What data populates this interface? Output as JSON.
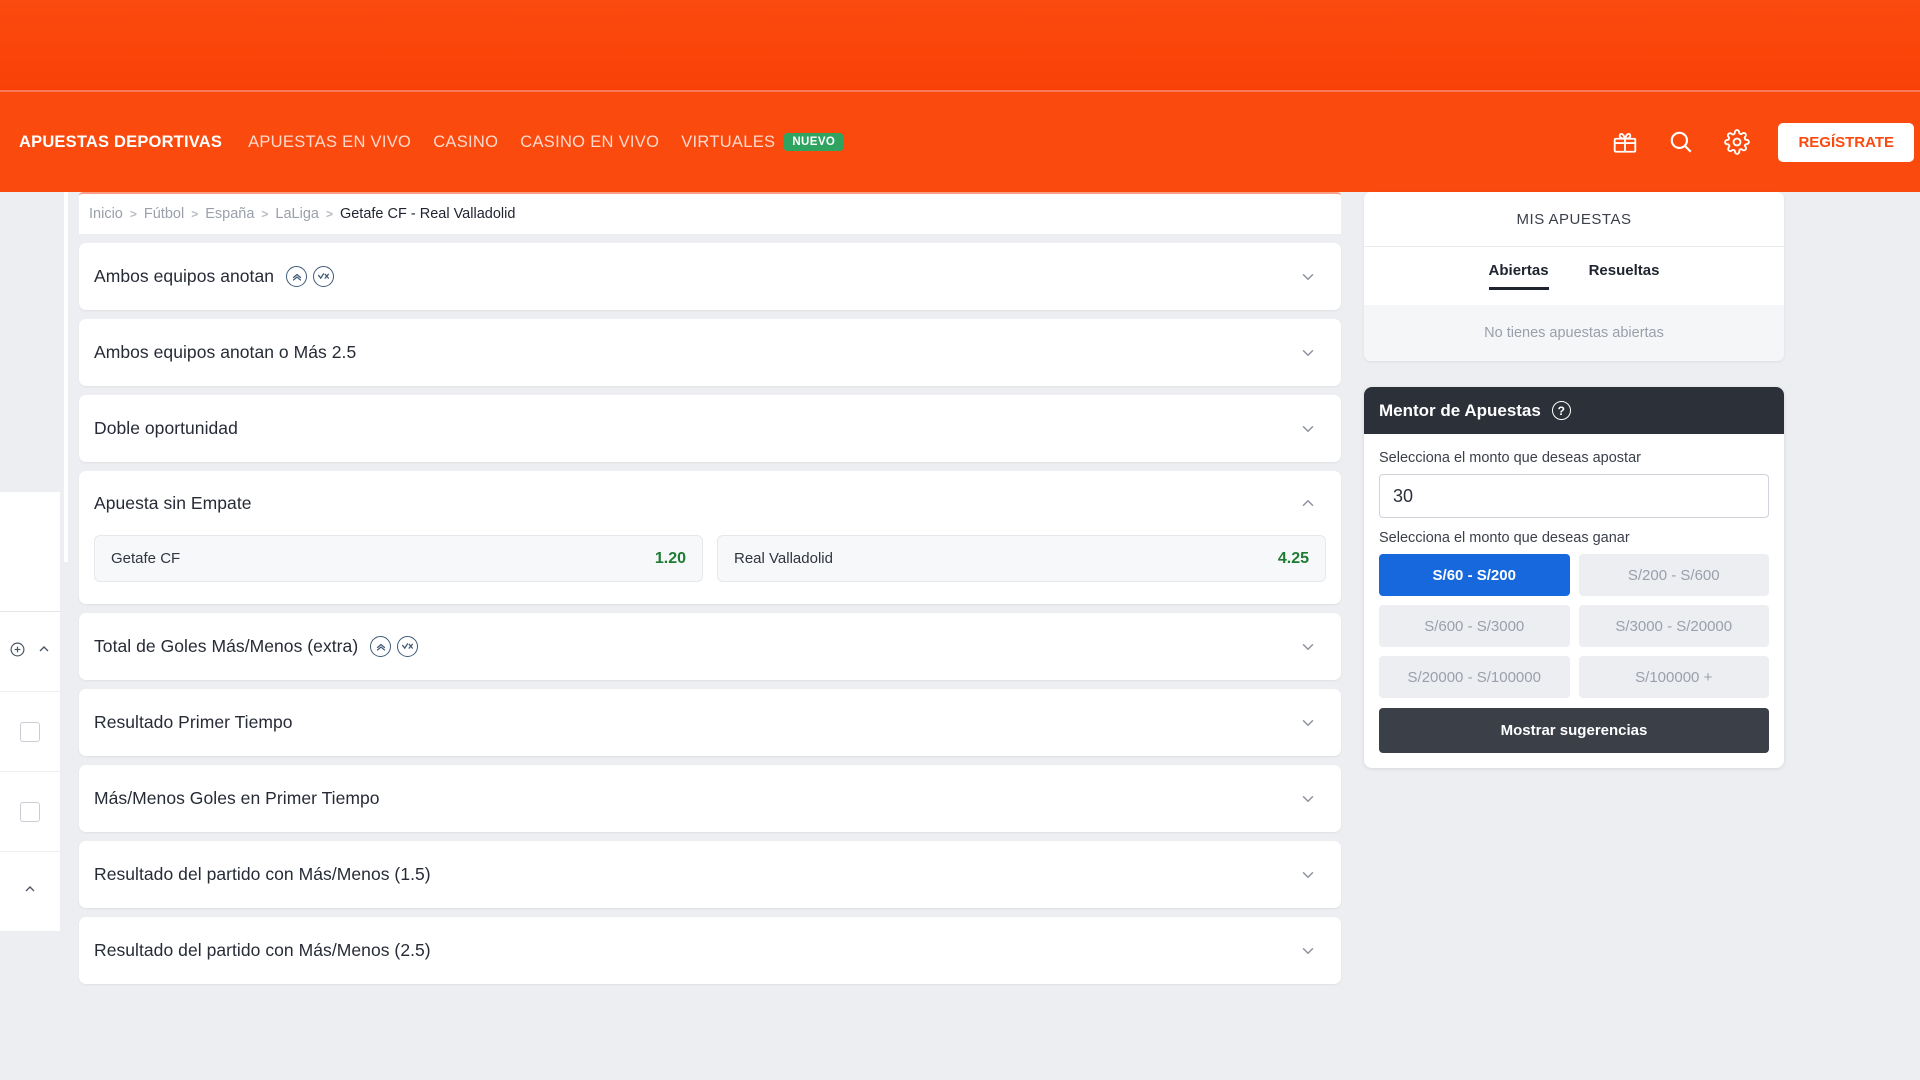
{
  "header": {
    "nav_items": [
      {
        "label": "APUESTAS DEPORTIVAS",
        "active": true,
        "badge": null
      },
      {
        "label": "APUESTAS EN VIVO",
        "active": false,
        "badge": null
      },
      {
        "label": "CASINO",
        "active": false,
        "badge": null
      },
      {
        "label": "CASINO EN VIVO",
        "active": false,
        "badge": null
      },
      {
        "label": "VIRTUALES",
        "active": false,
        "badge": "NUEVO"
      }
    ],
    "icons": [
      "gift-icon",
      "search-icon",
      "gear-icon"
    ],
    "register_label": "REGÍSTRATE",
    "brand_color": "#fb4a0e",
    "badge_color": "#2fa360"
  },
  "breadcrumb": {
    "items": [
      "Inicio",
      "Fútbol",
      "España",
      "LaLiga",
      "Getafe CF - Real Valladolid"
    ],
    "separator": ">"
  },
  "markets": [
    {
      "title": "Ambos equipos anotan",
      "icons": [
        "boost-icon",
        "cashout-icon"
      ],
      "open": false,
      "selections": []
    },
    {
      "title": "Ambos equipos anotan o Más 2.5",
      "icons": [],
      "open": false,
      "selections": []
    },
    {
      "title": "Doble oportunidad",
      "icons": [],
      "open": false,
      "selections": []
    },
    {
      "title": "Apuesta sin Empate",
      "icons": [],
      "open": true,
      "selections": [
        {
          "name": "Getafe CF",
          "odds": "1.20"
        },
        {
          "name": "Real Valladolid",
          "odds": "4.25"
        }
      ]
    },
    {
      "title": "Total de Goles Más/Menos (extra)",
      "icons": [
        "boost-icon",
        "cashout-icon"
      ],
      "open": false,
      "selections": []
    },
    {
      "title": "Resultado Primer Tiempo",
      "icons": [],
      "open": false,
      "selections": []
    },
    {
      "title": "Más/Menos Goles en Primer Tiempo",
      "icons": [],
      "open": false,
      "selections": []
    },
    {
      "title": "Resultado del partido con Más/Menos (1.5)",
      "icons": [],
      "open": false,
      "selections": []
    },
    {
      "title": "Resultado del partido con Más/Menos (2.5)",
      "icons": [],
      "open": false,
      "selections": []
    }
  ],
  "betslip": {
    "header": "MIS APUESTAS",
    "tabs": [
      {
        "label": "Abiertas",
        "active": true
      },
      {
        "label": "Resueltas",
        "active": false
      }
    ],
    "empty_text": "No tienes apuestas abiertas"
  },
  "mentor": {
    "title": "Mentor de Apuestas",
    "help_glyph": "?",
    "amount_label": "Selecciona el monto que deseas apostar",
    "amount_value": "30",
    "amount_placeholder": "Monto",
    "range_label": "Selecciona el monto que deseas ganar",
    "ranges": [
      {
        "label": "S/60 - S/200",
        "selected": true
      },
      {
        "label": "S/200 - S/600",
        "selected": false
      },
      {
        "label": "S/600 - S/3000",
        "selected": false
      },
      {
        "label": "S/3000 - S/20000",
        "selected": false
      },
      {
        "label": "S/20000 - S/100000",
        "selected": false
      },
      {
        "label": "S/100000 +",
        "selected": false
      }
    ],
    "cta_label": "Mostrar sugerencias",
    "accent_color": "#1668dc"
  }
}
